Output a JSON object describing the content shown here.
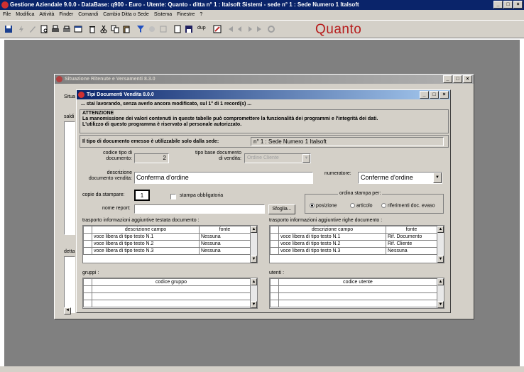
{
  "app": {
    "title": "Gestione Aziendale 9.0.0 - DataBase: q900 - Euro - Utente: Quanto - ditta n° 1 : Italsoft Sistemi - sede n° 1 : Sede Numero 1 Italsoft",
    "brand": "Quanto",
    "win_buttons": [
      "_",
      "□",
      "×"
    ]
  },
  "menu": [
    "File",
    "Modifica",
    "Attività",
    "Finder",
    "Comandi",
    "Cambio Ditta o Sede",
    "Sistema",
    "Finestre",
    "?"
  ],
  "toolbar": {
    "dup_label": "dup"
  },
  "outer_window": {
    "title": "Situazione Ritenute e Versamenti 8.3.0",
    "fragments": {
      "situa": "Situa",
      "saldi": "saldi",
      "detta": "detta"
    }
  },
  "inner_window": {
    "title": "Tipi Documenti Vendita 8.0.0",
    "status_line": "... stai lavorando, senza averlo ancora modificato, sul 1° di 1 record(s) ...",
    "warning_title": "ATTENZIONE",
    "warning_line1": "La manomissione dei valori contenuti in queste tabelle può compromettere la funzionalità dei programmi e l'integrità dei dati.",
    "warning_line2": "L'utilizzo di questo programma è riservato al personale autorizzato.",
    "sede_label": "Il tipo di documento emesso è utilizzabile solo dalla sede:",
    "sede_value": "n° 1 : Sede Numero 1 Italsoft",
    "codice_label1": "codice tipo di",
    "codice_label2": "documento:",
    "codice_value": "2",
    "tipo_base_label1": "tipo base documento",
    "tipo_base_label2": "di vendita:",
    "tipo_base_value": "Ordine Cliente",
    "descrizione_label1": "descrizione",
    "descrizione_label2": "documento vendita:",
    "descrizione_value": "Conferma d'ordine",
    "numeratore_label": "numeratore:",
    "numeratore_value": "Conferme d'ordine",
    "copie_label": "copie da stampare:",
    "copie_value": "1",
    "stampa_obbl_label": "stampa obbligatoria",
    "nome_report_label": "nome report:",
    "sfoglia_label": "Sfoglia...",
    "ordina_label": "ordina stampa per:",
    "ordina_options": [
      "posizione",
      "articolo",
      "riferimenti doc. evaso"
    ],
    "testata_title": "trasporto informazioni aggiuntive testata documento :",
    "righe_title": "trasporto informazioni aggiuntive righe documento :",
    "col_descrizione": "descrizione campo",
    "col_fonte": "fonte",
    "testata_rows": [
      {
        "descrizione": "voce libera di tipo testo N.1",
        "fonte": "Nessuna"
      },
      {
        "descrizione": "voce libera di tipo testo N.2",
        "fonte": "Nessuna"
      },
      {
        "descrizione": "voce libera di tipo testo N.3",
        "fonte": "Nessuna"
      }
    ],
    "righe_rows": [
      {
        "descrizione": "voce libera di tipo testo N.1",
        "fonte": "Rif. Documento"
      },
      {
        "descrizione": "voce libera di tipo testo N.2",
        "fonte": "Rif. Cliente"
      },
      {
        "descrizione": "voce libera di tipo testo N.3",
        "fonte": "Nessuna"
      }
    ],
    "gruppi_title": "gruppi :",
    "gruppi_col": "codice gruppo",
    "utenti_title": "utenti :",
    "utenti_col": "codice utente"
  }
}
